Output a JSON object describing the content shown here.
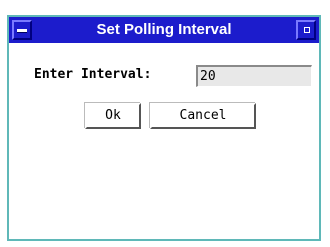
{
  "window": {
    "title": "Set Polling Interval",
    "menu_icon": "window-menu-icon",
    "maximize_icon": "maximize-icon"
  },
  "form": {
    "interval_label": "Enter Interval:",
    "interval_value": "20"
  },
  "buttons": {
    "ok_label": "Ok",
    "cancel_label": "Cancel"
  },
  "colors": {
    "titlebar": "#1c1ccc",
    "window_border": "#5fb8b8",
    "field_bg": "#e8e8e8"
  }
}
